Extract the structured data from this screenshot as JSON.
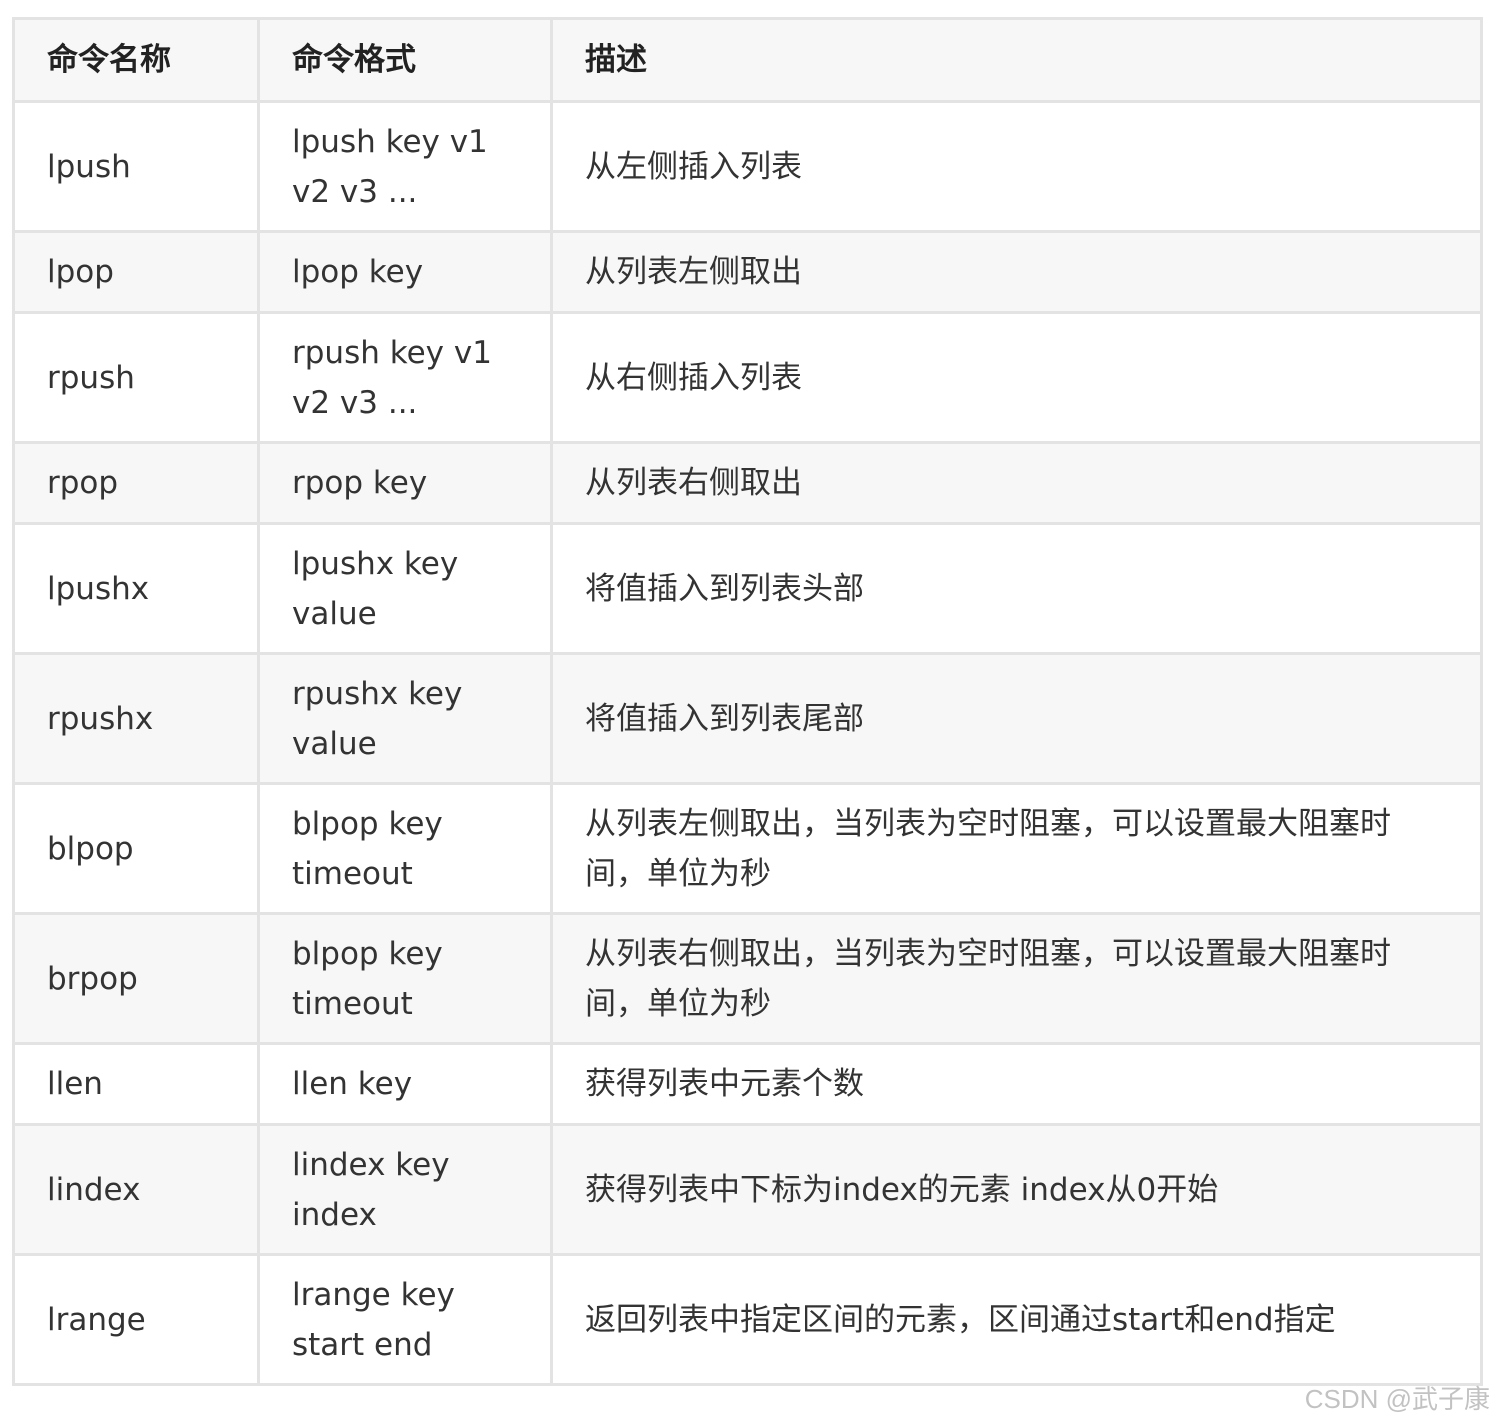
{
  "table": {
    "headers": {
      "name": "命令名称",
      "format": "命令格式",
      "description": "描述"
    },
    "rows": [
      {
        "name": "lpush",
        "format_line1": "lpush key v1",
        "format_line2": "v2 v3 ...",
        "desc_line1": "从左侧插入列表",
        "desc_line2": ""
      },
      {
        "name": "lpop",
        "format_line1": "lpop key",
        "format_line2": "",
        "desc_line1": "从列表左侧取出",
        "desc_line2": ""
      },
      {
        "name": "rpush",
        "format_line1": "rpush key v1",
        "format_line2": "v2 v3 ...",
        "desc_line1": "从右侧插入列表",
        "desc_line2": ""
      },
      {
        "name": "rpop",
        "format_line1": "rpop key",
        "format_line2": "",
        "desc_line1": "从列表右侧取出",
        "desc_line2": ""
      },
      {
        "name": "lpushx",
        "format_line1": "lpushx key",
        "format_line2": "value",
        "desc_line1": "将值插入到列表头部",
        "desc_line2": ""
      },
      {
        "name": "rpushx",
        "format_line1": "rpushx key",
        "format_line2": "value",
        "desc_line1": "将值插入到列表尾部",
        "desc_line2": ""
      },
      {
        "name": "blpop",
        "format_line1": "blpop key",
        "format_line2": "timeout",
        "desc_line1": "从列表左侧取出，当列表为空时阻塞，可以设置最大阻塞时",
        "desc_line2": "间，单位为秒"
      },
      {
        "name": "brpop",
        "format_line1": "blpop key",
        "format_line2": "timeout",
        "desc_line1": "从列表右侧取出，当列表为空时阻塞，可以设置最大阻塞时",
        "desc_line2": "间，单位为秒"
      },
      {
        "name": "llen",
        "format_line1": "llen key",
        "format_line2": "",
        "desc_line1": "获得列表中元素个数",
        "desc_line2": ""
      },
      {
        "name": "lindex",
        "format_line1": "lindex key",
        "format_line2": "index",
        "desc_line1": "获得列表中下标为index的元素 index从0开始",
        "desc_line2": ""
      },
      {
        "name": "lrange",
        "format_line1": "lrange key",
        "format_line2": "start end",
        "desc_line1": "返回列表中指定区间的元素，区间通过start和end指定",
        "desc_line2": ""
      }
    ]
  },
  "watermark": "CSDN @武子康",
  "colors": {
    "border": "#e3e3e3",
    "stripe": "#f7f7f7",
    "text": "#333333"
  }
}
